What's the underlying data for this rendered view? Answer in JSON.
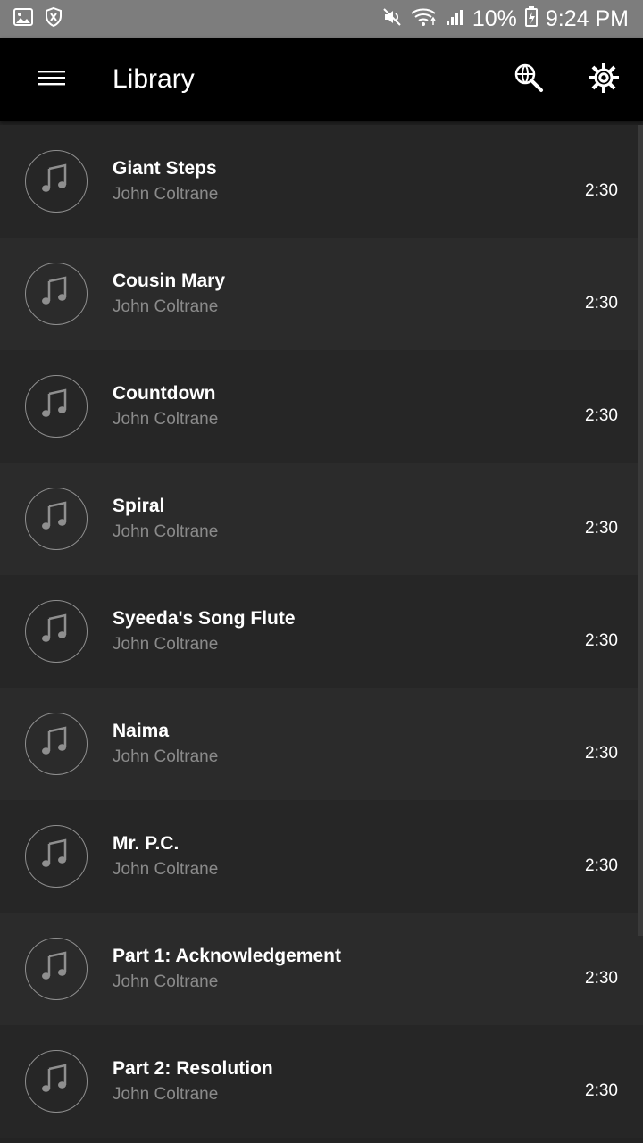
{
  "status_bar": {
    "left_icons": [
      "image-icon",
      "shield-icon"
    ],
    "battery_percent": "10%",
    "time": "9:24 PM",
    "right_icons": [
      "muted-icon",
      "wifi-icon",
      "signal-icon",
      "battery-icon"
    ]
  },
  "app_bar": {
    "menu_icon": "menu-icon",
    "title": "Library",
    "actions": [
      "globe-search-icon",
      "settings-icon"
    ]
  },
  "songs": [
    {
      "title": "Giant Steps",
      "artist": "John Coltrane",
      "duration": "2:30"
    },
    {
      "title": "Cousin Mary",
      "artist": "John Coltrane",
      "duration": "2:30"
    },
    {
      "title": "Countdown",
      "artist": "John Coltrane",
      "duration": "2:30"
    },
    {
      "title": "Spiral",
      "artist": "John Coltrane",
      "duration": "2:30"
    },
    {
      "title": "Syeeda's Song Flute",
      "artist": "John Coltrane",
      "duration": "2:30"
    },
    {
      "title": "Naima",
      "artist": "John Coltrane",
      "duration": "2:30"
    },
    {
      "title": "Mr. P.C.",
      "artist": "John Coltrane",
      "duration": "2:30"
    },
    {
      "title": "Part 1: Acknowledgement",
      "artist": "John Coltrane",
      "duration": "2:30"
    },
    {
      "title": "Part 2: Resolution",
      "artist": "John Coltrane",
      "duration": "2:30"
    }
  ],
  "colors": {
    "background": "#232323",
    "row_dark": "#262626",
    "row_light": "#2b2b2b",
    "app_bar": "#000000",
    "status_bar": "#7d7d7d",
    "text_primary": "#ffffff",
    "text_secondary": "#8a8a8a"
  }
}
